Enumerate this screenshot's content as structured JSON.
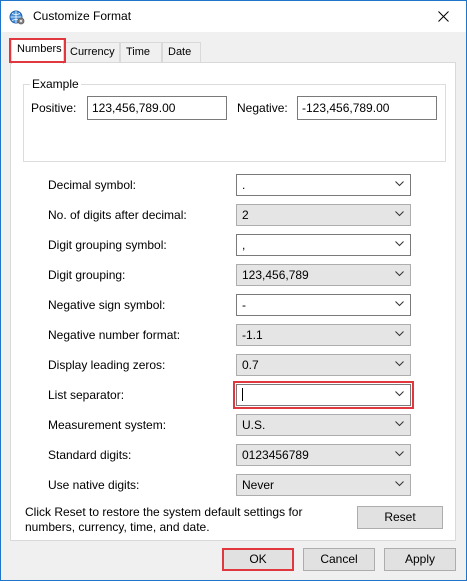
{
  "window": {
    "title": "Customize Format",
    "app_icon": "globe-settings-icon",
    "close_icon": "close-icon"
  },
  "tabs": [
    {
      "label": "Numbers",
      "active": true
    },
    {
      "label": "Currency",
      "active": false
    },
    {
      "label": "Time",
      "active": false
    },
    {
      "label": "Date",
      "active": false
    }
  ],
  "example": {
    "title": "Example",
    "positive_label": "Positive:",
    "positive_value": "123,456,789.00",
    "negative_label": "Negative:",
    "negative_value": "-123,456,789.00"
  },
  "settings": [
    {
      "label": "Decimal symbol:",
      "value": ".",
      "editable": true
    },
    {
      "label": "No. of digits after decimal:",
      "value": "2",
      "editable": false
    },
    {
      "label": "Digit grouping symbol:",
      "value": ",",
      "editable": true
    },
    {
      "label": "Digit grouping:",
      "value": "123,456,789",
      "editable": false
    },
    {
      "label": "Negative sign symbol:",
      "value": "-",
      "editable": true
    },
    {
      "label": "Negative number format:",
      "value": "-1.1",
      "editable": false
    },
    {
      "label": "Display leading zeros:",
      "value": "0.7",
      "editable": false
    },
    {
      "label": "List separator:",
      "value": "",
      "editable": true,
      "focused": true
    },
    {
      "label": "Measurement system:",
      "value": "U.S.",
      "editable": false
    },
    {
      "label": "Standard digits:",
      "value": "0123456789",
      "editable": false
    },
    {
      "label": "Use native digits:",
      "value": "Never",
      "editable": false
    }
  ],
  "reset": {
    "help_text": "Click Reset to restore the system default settings for numbers, currency, time, and date.",
    "button_label": "Reset"
  },
  "footer": {
    "ok_label": "OK",
    "cancel_label": "Cancel",
    "apply_label": "Apply"
  },
  "colors": {
    "highlight": "#e0383e",
    "window_border": "#1f75c9",
    "default_button_border": "#0078d7"
  }
}
